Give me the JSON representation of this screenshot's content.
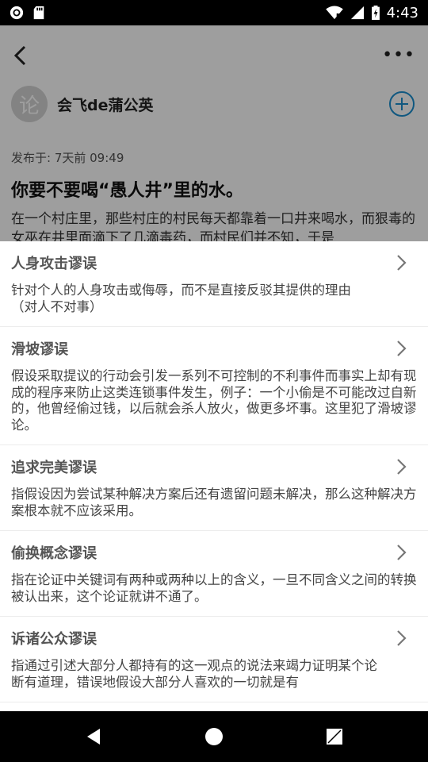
{
  "status_bar": {
    "time": "4:43",
    "left_icons": [
      "record-icon",
      "sd-card-icon"
    ],
    "right_icons": [
      "wifi-icon",
      "signal-icon",
      "battery-charging-icon"
    ]
  },
  "article": {
    "author": "会飞de蒲公英",
    "avatar_text": "论",
    "published": "发布于: 7天前 09:49",
    "title": "你要不要喝“愚人井”里的水。",
    "body": "在一个村庄里，那些村庄的村民每天都靠着一口井来喝水，而狠毒的女巫在井里面滴下了几滴毒药，而村民们并不知，于是"
  },
  "fallacies": [
    {
      "title": "人身攻击谬误",
      "description": "针对个人的人身攻击或侮辱，而不是直接反驳其提供的理由（对人不对事）"
    },
    {
      "title": "滑坡谬误",
      "description": "假设采取提议的行动会引发一系列不可控制的不利事件而事实上却有现成的程序来防止这类连锁事件发生，例子：一个小偷是不可能改过自新的，他曾经偷过钱，以后就会杀人放火，做更多坏事。这里犯了滑坡谬论。"
    },
    {
      "title": "追求完美谬误",
      "description": "指假设因为尝试某种解决方案后还有遗留问题未解决，那么这种解决方案根本就不应该采用。"
    },
    {
      "title": "偷换概念谬误",
      "description": "指在论证中关键词有两种或两种以上的含义，一旦不同含义之间的转换被认出来，这个论证就讲不通了。"
    },
    {
      "title": "诉诸公众谬误",
      "description": "指通过引述大部分人都持有的这一观点的说法来竭力证明某个论断有道理，错误地假设大部分人喜欢的一切就是有"
    }
  ],
  "colors": {
    "accent": "#1a8ecf",
    "overlay": "rgba(0,0,0,0.38)"
  }
}
